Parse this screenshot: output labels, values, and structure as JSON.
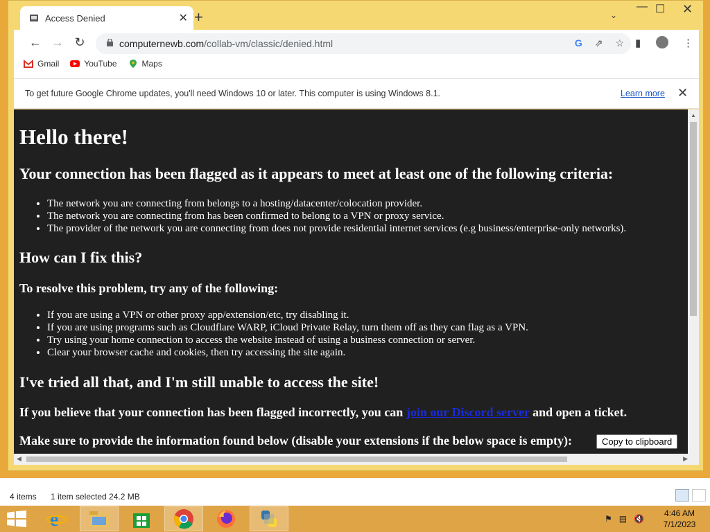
{
  "explorer_status": {
    "items": "4 items",
    "selection": "1 item selected  24.2 MB"
  },
  "browser": {
    "tab_title": "Access Denied",
    "url_host": "computernewb.com",
    "url_path": "/collab-vm/classic/denied.html",
    "bookmarks": [
      {
        "label": "Gmail",
        "icon": "gmail-icon"
      },
      {
        "label": "YouTube",
        "icon": "youtube-icon"
      },
      {
        "label": "Maps",
        "icon": "maps-icon"
      }
    ],
    "infobar": {
      "message": "To get future Google Chrome updates, you'll need Windows 10 or later. This computer is using Windows 8.1.",
      "link": "Learn more"
    }
  },
  "page": {
    "hello": "Hello there!",
    "criteria_heading": "Your connection has been flagged as it appears to meet at least one of the following criteria:",
    "criteria": [
      "The network you are connecting from belongs to a hosting/datacenter/colocation provider.",
      "The network you are connecting from has been confirmed to belong to a VPN or proxy service.",
      "The provider of the network you are connecting from does not provide residential internet services (e.g business/enterprise-only networks)."
    ],
    "fix_heading": "How can I fix this?",
    "resolve_heading": "To resolve this problem, try any of the following:",
    "fixes": [
      "If you are using a VPN or other proxy app/extension/etc, try disabling it.",
      "If you are using programs such as Cloudflare WARP, iCloud Private Relay, turn them off as they can flag as a VPN.",
      "Try using your home connection to access the website instead of using a business connection or server.",
      "Clear your browser cache and cookies, then try accessing the site again."
    ],
    "tried_heading": "I've tried all that, and I'm still unable to access the site!",
    "believe_pre": "If you believe that your connection has been flagged incorrectly, you can ",
    "believe_link": "join our Discord server",
    "believe_post": " and open a ticket.",
    "provide_text": "Make sure to provide the information found below (disable your extensions if the below space is empty):",
    "copy_button": "Copy to clipboard"
  },
  "taskbar": {
    "apps": [
      "internet-explorer",
      "file-explorer",
      "store",
      "chrome",
      "firefox",
      "python"
    ],
    "time": "4:46 AM",
    "date": "7/1/2023"
  },
  "colors": {
    "page_bg": "#202020",
    "link": "#1a2bd8",
    "taskbar": "#dfa445",
    "window_frame": "#f6d873"
  }
}
